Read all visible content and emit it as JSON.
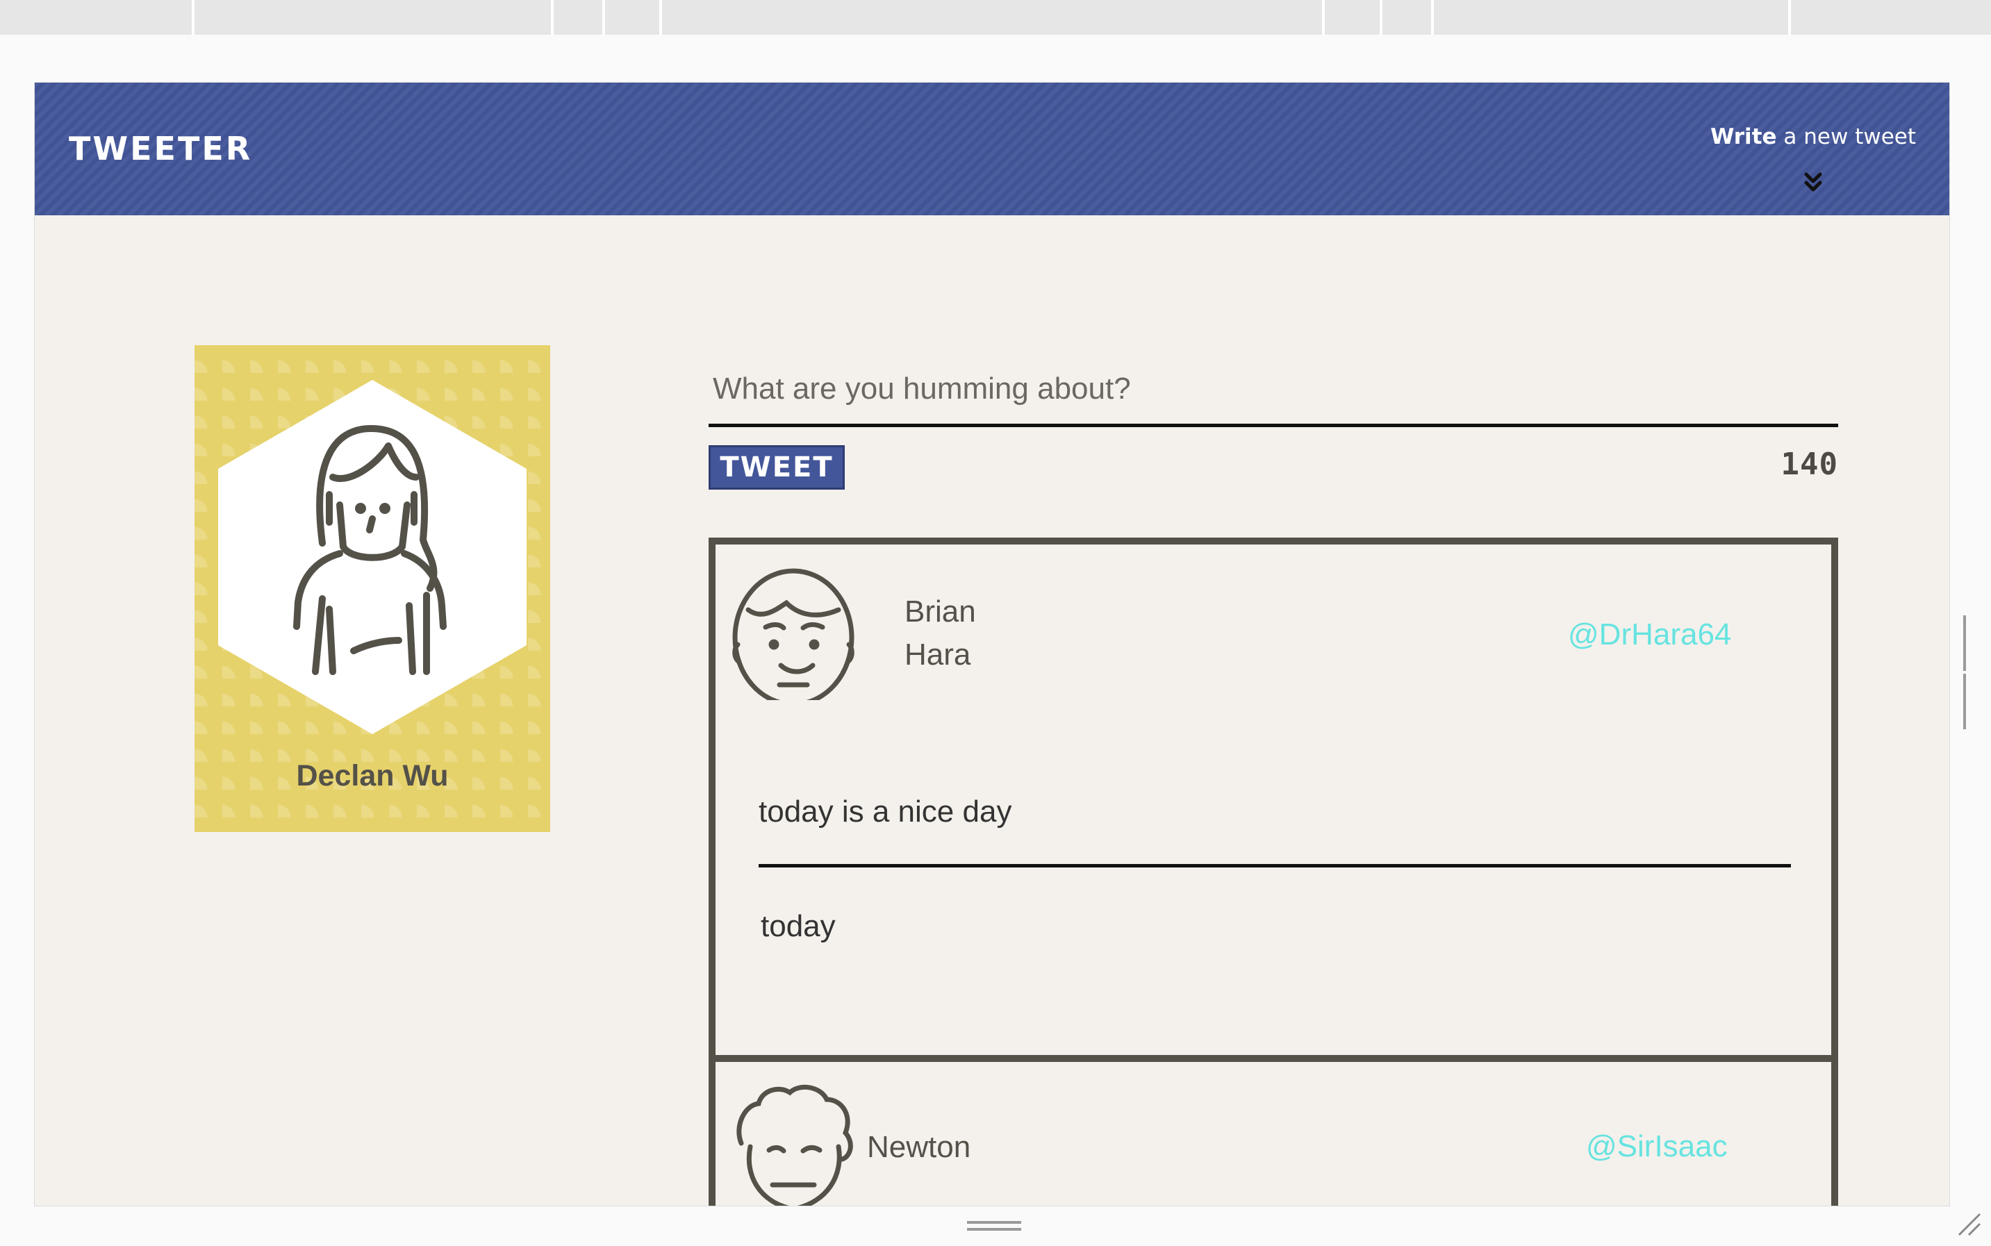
{
  "app": {
    "brand": "TWEETER"
  },
  "nav": {
    "compose_bold": "Write",
    "compose_rest": " a new tweet",
    "chevron_icon": "double-chevron-down-icon"
  },
  "profile": {
    "name": "Declan Wu",
    "avatar_icon": "woman-avatar-icon",
    "card_color": "#e6d26b"
  },
  "composer": {
    "placeholder": "What are you humming about?",
    "value": "",
    "button_label": "TWEET",
    "char_count": "140"
  },
  "tweets": [
    {
      "name_line1": "Brian",
      "name_line2": "Hara",
      "handle": "@DrHara64",
      "body": "today is a nice day",
      "meta": "today",
      "avatar_icon": "smiling-man-avatar-icon"
    },
    {
      "name_line1": "Newton",
      "handle": "@SirIsaac",
      "avatar_icon": "curly-hair-man-avatar-icon"
    }
  ],
  "colors": {
    "nav": "#435699",
    "background": "#f4f1ec",
    "handle": "#67e3e0",
    "border": "#545149"
  }
}
